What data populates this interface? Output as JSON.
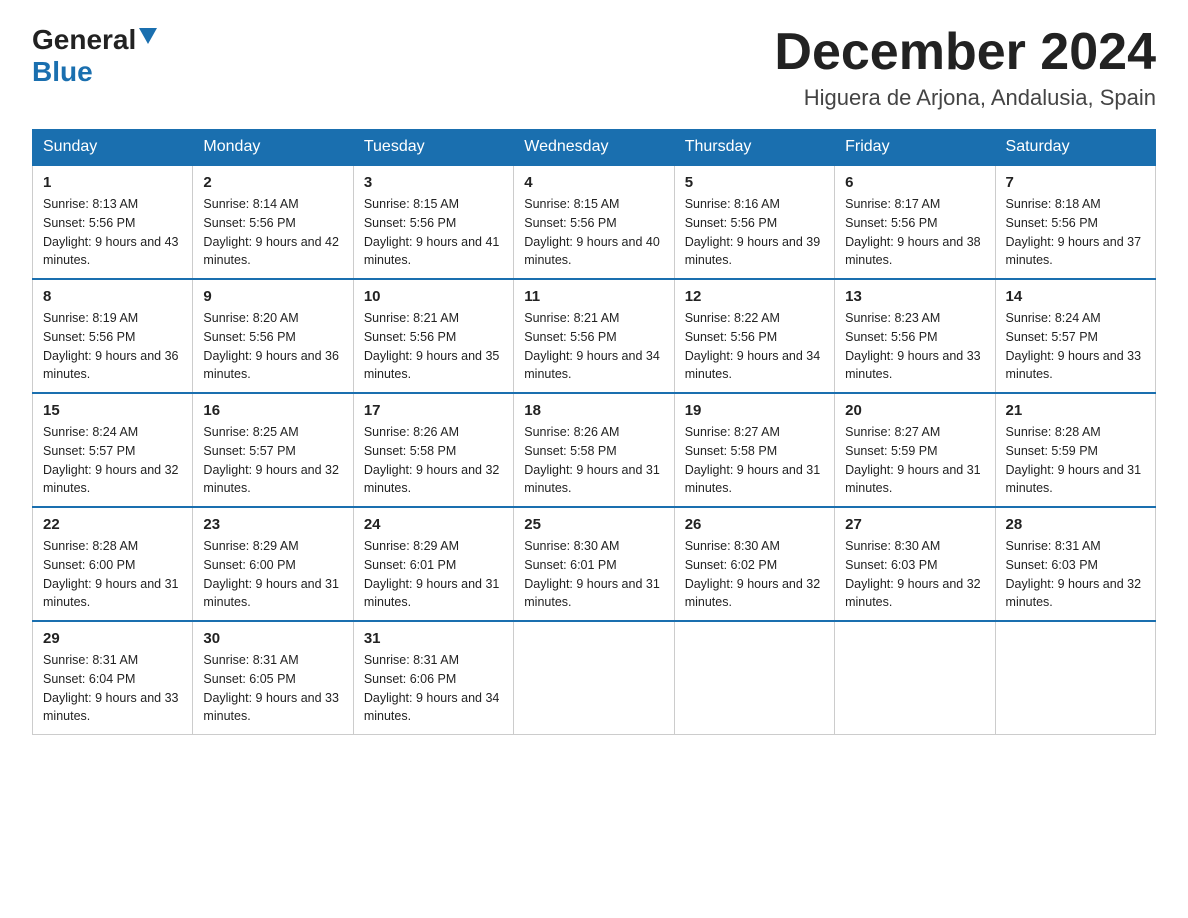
{
  "header": {
    "logo_general": "General",
    "logo_blue": "Blue",
    "month_title": "December 2024",
    "subtitle": "Higuera de Arjona, Andalusia, Spain"
  },
  "weekdays": [
    "Sunday",
    "Monday",
    "Tuesday",
    "Wednesday",
    "Thursday",
    "Friday",
    "Saturday"
  ],
  "weeks": [
    [
      {
        "day": 1,
        "sunrise": "8:13 AM",
        "sunset": "5:56 PM",
        "daylight": "9 hours and 43 minutes."
      },
      {
        "day": 2,
        "sunrise": "8:14 AM",
        "sunset": "5:56 PM",
        "daylight": "9 hours and 42 minutes."
      },
      {
        "day": 3,
        "sunrise": "8:15 AM",
        "sunset": "5:56 PM",
        "daylight": "9 hours and 41 minutes."
      },
      {
        "day": 4,
        "sunrise": "8:15 AM",
        "sunset": "5:56 PM",
        "daylight": "9 hours and 40 minutes."
      },
      {
        "day": 5,
        "sunrise": "8:16 AM",
        "sunset": "5:56 PM",
        "daylight": "9 hours and 39 minutes."
      },
      {
        "day": 6,
        "sunrise": "8:17 AM",
        "sunset": "5:56 PM",
        "daylight": "9 hours and 38 minutes."
      },
      {
        "day": 7,
        "sunrise": "8:18 AM",
        "sunset": "5:56 PM",
        "daylight": "9 hours and 37 minutes."
      }
    ],
    [
      {
        "day": 8,
        "sunrise": "8:19 AM",
        "sunset": "5:56 PM",
        "daylight": "9 hours and 36 minutes."
      },
      {
        "day": 9,
        "sunrise": "8:20 AM",
        "sunset": "5:56 PM",
        "daylight": "9 hours and 36 minutes."
      },
      {
        "day": 10,
        "sunrise": "8:21 AM",
        "sunset": "5:56 PM",
        "daylight": "9 hours and 35 minutes."
      },
      {
        "day": 11,
        "sunrise": "8:21 AM",
        "sunset": "5:56 PM",
        "daylight": "9 hours and 34 minutes."
      },
      {
        "day": 12,
        "sunrise": "8:22 AM",
        "sunset": "5:56 PM",
        "daylight": "9 hours and 34 minutes."
      },
      {
        "day": 13,
        "sunrise": "8:23 AM",
        "sunset": "5:56 PM",
        "daylight": "9 hours and 33 minutes."
      },
      {
        "day": 14,
        "sunrise": "8:24 AM",
        "sunset": "5:57 PM",
        "daylight": "9 hours and 33 minutes."
      }
    ],
    [
      {
        "day": 15,
        "sunrise": "8:24 AM",
        "sunset": "5:57 PM",
        "daylight": "9 hours and 32 minutes."
      },
      {
        "day": 16,
        "sunrise": "8:25 AM",
        "sunset": "5:57 PM",
        "daylight": "9 hours and 32 minutes."
      },
      {
        "day": 17,
        "sunrise": "8:26 AM",
        "sunset": "5:58 PM",
        "daylight": "9 hours and 32 minutes."
      },
      {
        "day": 18,
        "sunrise": "8:26 AM",
        "sunset": "5:58 PM",
        "daylight": "9 hours and 31 minutes."
      },
      {
        "day": 19,
        "sunrise": "8:27 AM",
        "sunset": "5:58 PM",
        "daylight": "9 hours and 31 minutes."
      },
      {
        "day": 20,
        "sunrise": "8:27 AM",
        "sunset": "5:59 PM",
        "daylight": "9 hours and 31 minutes."
      },
      {
        "day": 21,
        "sunrise": "8:28 AM",
        "sunset": "5:59 PM",
        "daylight": "9 hours and 31 minutes."
      }
    ],
    [
      {
        "day": 22,
        "sunrise": "8:28 AM",
        "sunset": "6:00 PM",
        "daylight": "9 hours and 31 minutes."
      },
      {
        "day": 23,
        "sunrise": "8:29 AM",
        "sunset": "6:00 PM",
        "daylight": "9 hours and 31 minutes."
      },
      {
        "day": 24,
        "sunrise": "8:29 AM",
        "sunset": "6:01 PM",
        "daylight": "9 hours and 31 minutes."
      },
      {
        "day": 25,
        "sunrise": "8:30 AM",
        "sunset": "6:01 PM",
        "daylight": "9 hours and 31 minutes."
      },
      {
        "day": 26,
        "sunrise": "8:30 AM",
        "sunset": "6:02 PM",
        "daylight": "9 hours and 32 minutes."
      },
      {
        "day": 27,
        "sunrise": "8:30 AM",
        "sunset": "6:03 PM",
        "daylight": "9 hours and 32 minutes."
      },
      {
        "day": 28,
        "sunrise": "8:31 AM",
        "sunset": "6:03 PM",
        "daylight": "9 hours and 32 minutes."
      }
    ],
    [
      {
        "day": 29,
        "sunrise": "8:31 AM",
        "sunset": "6:04 PM",
        "daylight": "9 hours and 33 minutes."
      },
      {
        "day": 30,
        "sunrise": "8:31 AM",
        "sunset": "6:05 PM",
        "daylight": "9 hours and 33 minutes."
      },
      {
        "day": 31,
        "sunrise": "8:31 AM",
        "sunset": "6:06 PM",
        "daylight": "9 hours and 34 minutes."
      },
      null,
      null,
      null,
      null
    ]
  ]
}
